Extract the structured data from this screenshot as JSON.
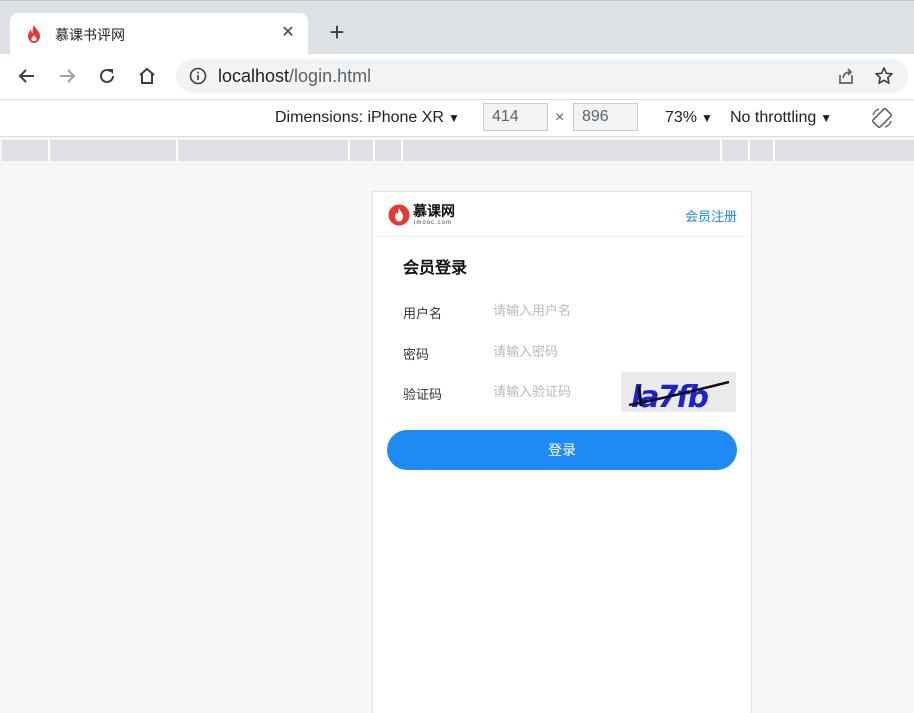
{
  "browser": {
    "tab": {
      "title": "慕课书评网",
      "close_icon": "close-icon"
    },
    "new_tab_label": "+",
    "url_host": "localhost",
    "url_path": "/login.html"
  },
  "devtools": {
    "dimensions_label": "Dimensions: iPhone XR",
    "width": "414",
    "height": "896",
    "times_sign": "×",
    "zoom": "73%",
    "throttling": "No throttling",
    "caret": "▼"
  },
  "page": {
    "logo": {
      "text": "慕课网",
      "subtext": "imooc.com"
    },
    "register_link": "会员注册",
    "form": {
      "title": "会员登录",
      "fields": [
        {
          "label": "用户名",
          "placeholder": "请输入用户名"
        },
        {
          "label": "密码",
          "placeholder": "请输入密码"
        },
        {
          "label": "验证码",
          "placeholder": "请输入验证码"
        }
      ],
      "captcha_text": "la7fb",
      "submit_label": "登录"
    }
  },
  "colors": {
    "accent": "#1e8af5",
    "link": "#1e88e5",
    "logo_red": "#e53935"
  }
}
